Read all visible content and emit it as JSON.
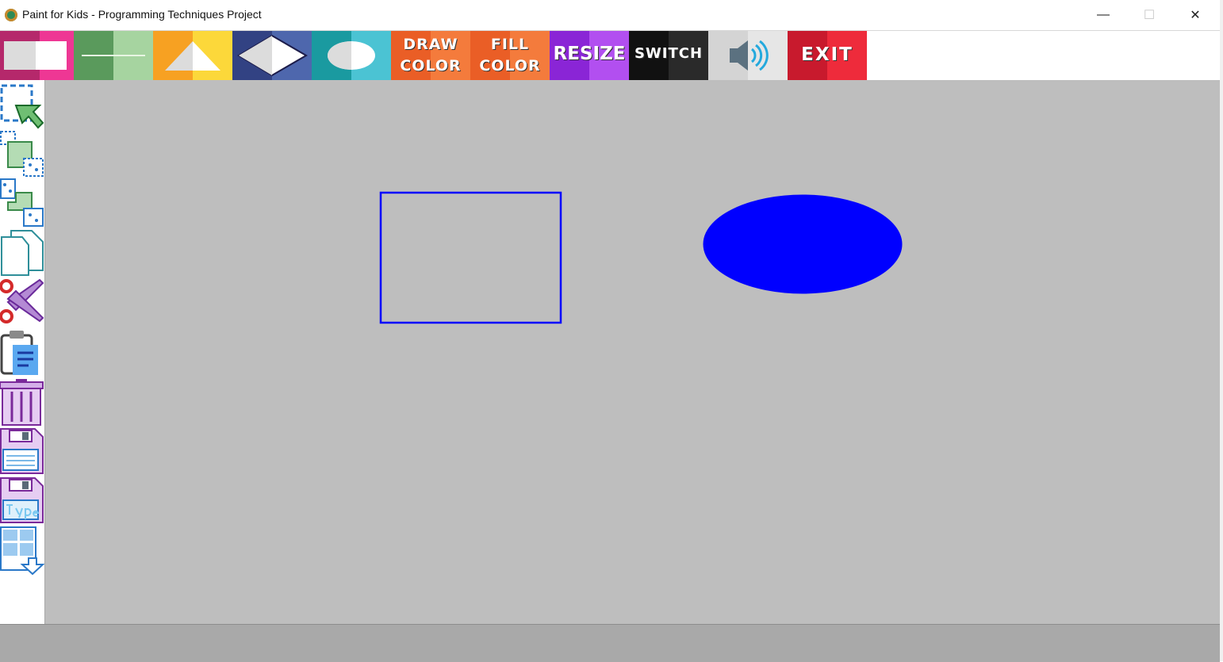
{
  "window": {
    "title": "Paint for Kids - Programming Techniques Project",
    "minimize_glyph": "—",
    "maximize_glyph": "☐",
    "close_glyph": "✕"
  },
  "toolbar": {
    "draw_color_line1": "DRAW",
    "draw_color_line2": "COLOR",
    "fill_color_line1": "FILL",
    "fill_color_line2": "COLOR",
    "resize_label": "RESIZE",
    "switch_label": "SWITCH",
    "exit_label": "EXIT"
  },
  "sidebar_tools": [
    "select-icon",
    "copy-icon",
    "move-icon",
    "new-page-icon",
    "cut-icon",
    "paste-icon",
    "delete-icon",
    "save-icon",
    "save-type-icon",
    "load-icon"
  ],
  "canvas": {
    "background": "#bebebe",
    "shapes": [
      {
        "kind": "rectangle",
        "stroke": "#0000ff",
        "fill": "none"
      },
      {
        "kind": "ellipse",
        "stroke": "#0000ff",
        "fill": "#0000ff"
      }
    ]
  },
  "colors": {
    "draw_color": "#0000ff",
    "fill_color": "#0000ff"
  }
}
